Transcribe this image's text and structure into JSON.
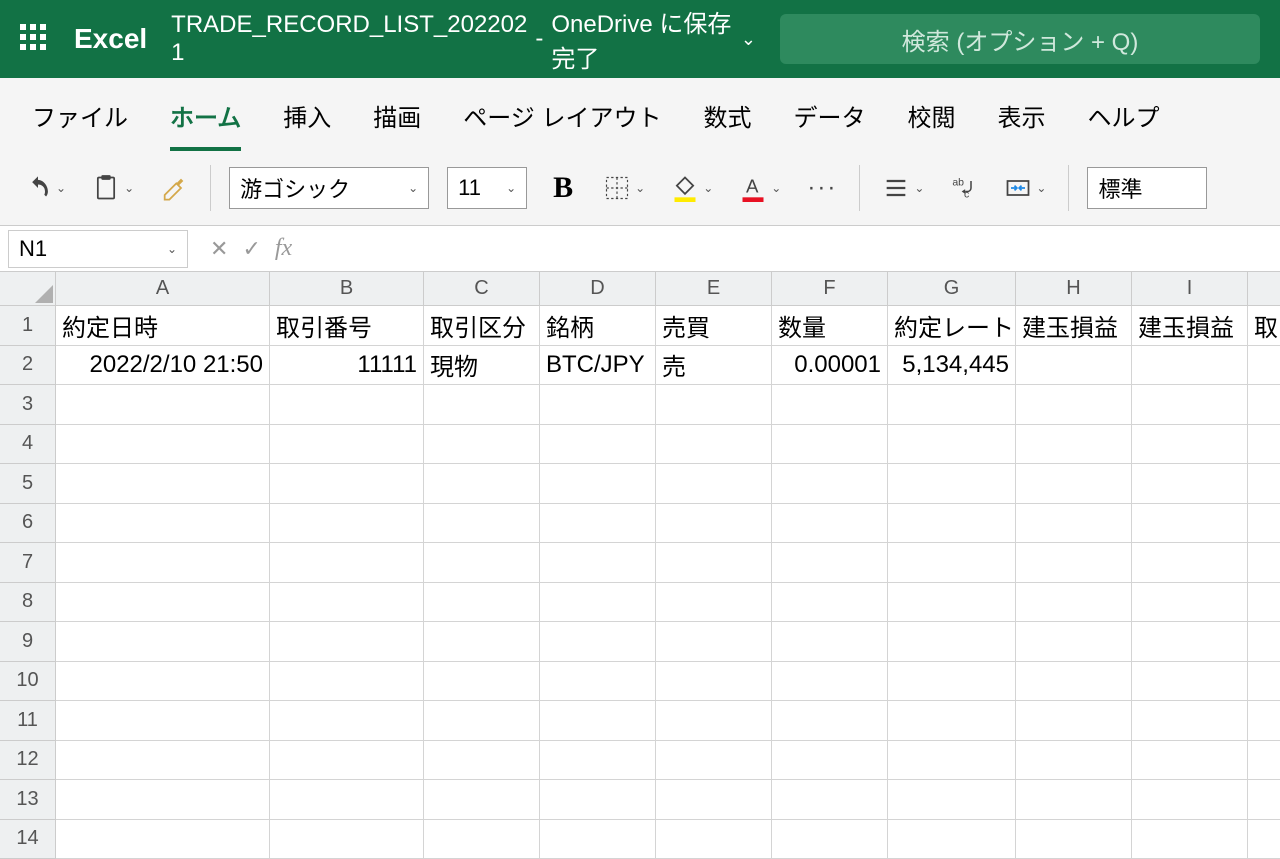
{
  "titlebar": {
    "app_name": "Excel",
    "doc_title": "TRADE_RECORD_LIST_202202 1",
    "save_status": "OneDrive に保存完了",
    "search_placeholder": "検索 (オプション + Q)"
  },
  "tabs": [
    "ファイル",
    "ホーム",
    "挿入",
    "描画",
    "ページ レイアウト",
    "数式",
    "データ",
    "校閲",
    "表示",
    "ヘルプ"
  ],
  "active_tab": 1,
  "ribbon": {
    "font_name": "游ゴシック",
    "font_size": "11",
    "num_format": "標準"
  },
  "formulabar": {
    "namebox": "N1",
    "formula": ""
  },
  "columns": [
    "A",
    "B",
    "C",
    "D",
    "E",
    "F",
    "G",
    "H",
    "I",
    ""
  ],
  "col_widths": [
    "wA",
    "wB",
    "wC",
    "wD",
    "wE",
    "wF",
    "wG",
    "wH",
    "wI",
    "wJ"
  ],
  "row_numbers": [
    1,
    2,
    3,
    4,
    5,
    6,
    7,
    8,
    9,
    10,
    11,
    12,
    13,
    14
  ],
  "sheet": {
    "headers": [
      "約定日時",
      "取引番号",
      "取引区分",
      "銘柄",
      "売買",
      "数量",
      "約定レート",
      "建玉損益",
      "建玉損益",
      "取引"
    ],
    "row2": [
      "2022/2/10 21:50",
      "11111",
      "現物",
      "BTC/JPY",
      "売",
      "0.00001",
      "5,134,445",
      "",
      "",
      ""
    ]
  },
  "cell_align_row2": [
    "right",
    "right",
    "left",
    "left",
    "left",
    "right",
    "right",
    "left",
    "left",
    "left"
  ]
}
